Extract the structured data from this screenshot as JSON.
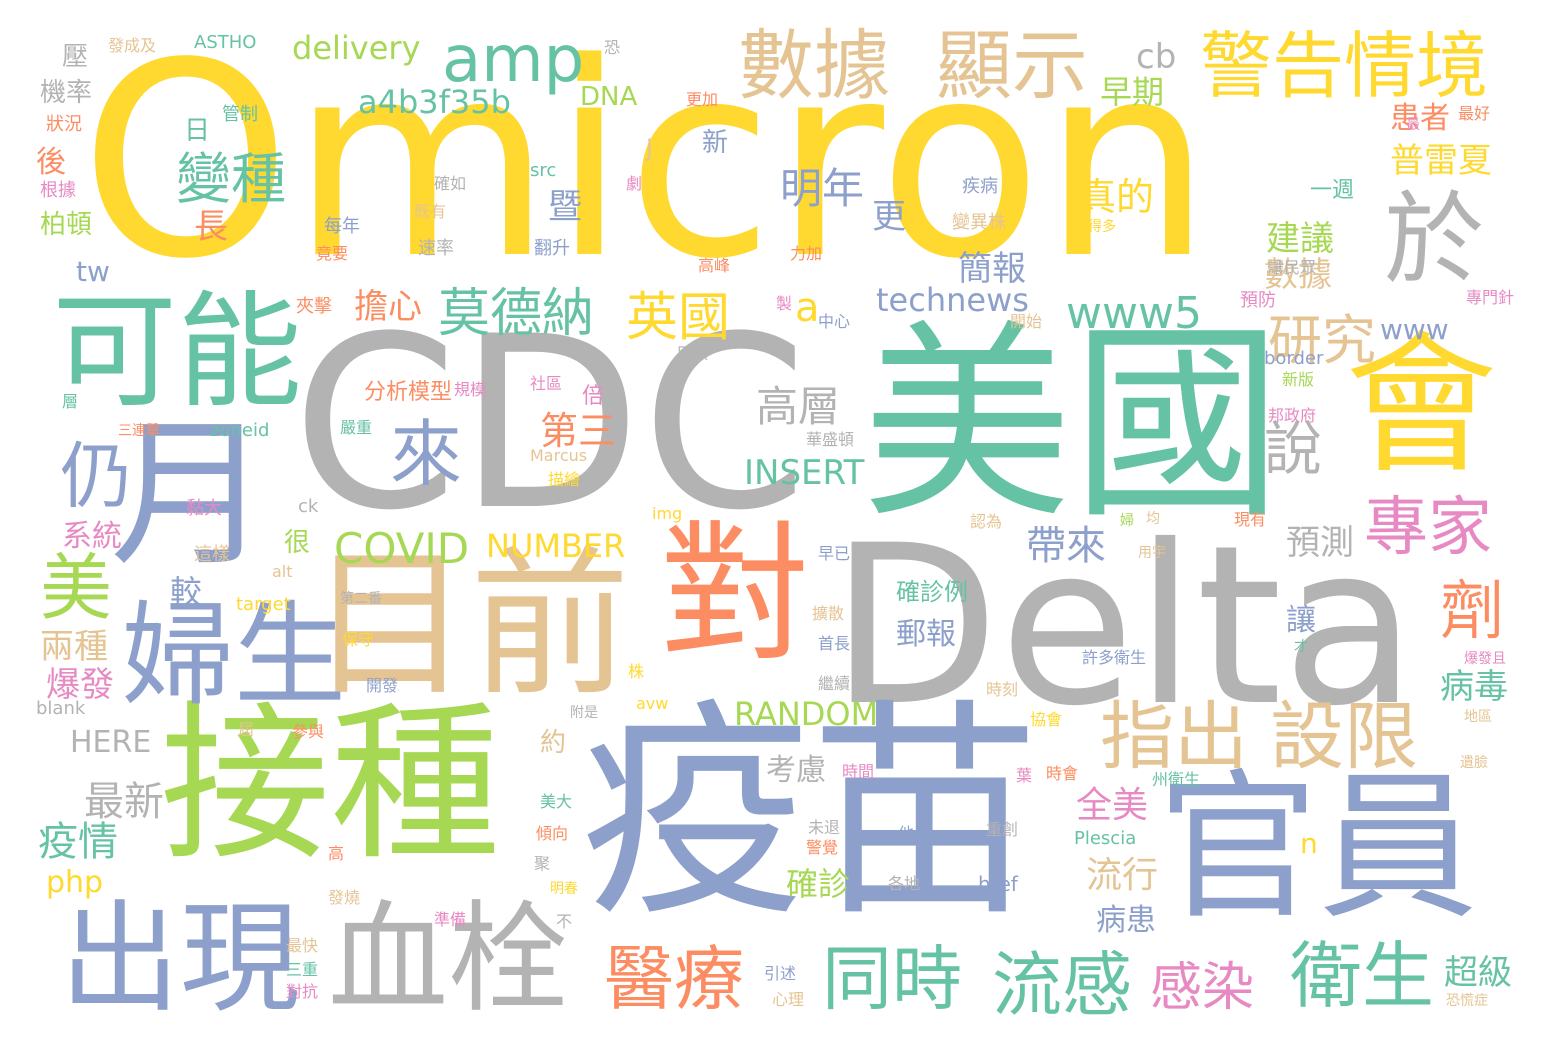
{
  "colors": {
    "yellow": "#ffd92f",
    "grey": "#b3b3b3",
    "green": "#66c2a5",
    "blue": "#8da0cb",
    "orange": "#fc8d62",
    "tan": "#e5c494",
    "lime": "#a6d854",
    "pink": "#e78ac3"
  },
  "words": [
    "Omicron",
    "CDC",
    "Delta",
    "美國",
    "疫苗",
    "接種",
    "目前",
    "對",
    "官員",
    "會",
    "月",
    "可能",
    "婦生",
    "出現",
    "血栓",
    "數據",
    "顯示",
    "警告情境",
    "amp",
    "於",
    "變種",
    "來",
    "仍",
    "美",
    "莫德納",
    "英國",
    "a",
    "www5",
    "technews",
    "研究",
    "說",
    "專家",
    "劑",
    "指出",
    "設限",
    "醫療",
    "同時",
    "流感",
    "衛生",
    "感染",
    "COVID",
    "NUMBER",
    "高層",
    "第三",
    "INSERT",
    "帶來",
    "預測",
    "a4b3f35b",
    "delivery",
    "DNA",
    "早期",
    "cb",
    "明年",
    "暨",
    "更",
    "簡報",
    "擔心",
    "分析模型",
    "倍",
    "全美",
    "流行",
    "病患",
    "確診",
    "考慮",
    "約",
    "最新",
    "疫情",
    "php",
    "系統",
    "兩種",
    "爆發",
    "RANDOM",
    "HERE",
    "病毒",
    "超級",
    "讓",
    "數據",
    "建議",
    "一週",
    "普雷夏",
    "患者",
    "真的",
    "日",
    "長",
    "tw",
    "柏頓",
    "機率",
    "壓",
    "後",
    "狀況",
    "根據",
    "較",
    "很",
    "郵報",
    "確診例",
    "src",
    "ASTHO",
    "發成及",
    "恐",
    "管制",
    "每年",
    "竟要",
    "速率",
    "翻升",
    "高峰",
    "力加",
    "變異株",
    "小得多",
    "疾病",
    "既有",
    "確如",
    "新",
    "J",
    "劇",
    "更加",
    "夾擊",
    "中心",
    "製",
    "預防",
    "讓民眾",
    "專門針",
    "開始",
    "足以",
    "border",
    "新版",
    "邦政府",
    "社區",
    "嚴重",
    "規模",
    "華盛頓",
    "Marcus",
    "描繪",
    "zoneid",
    "層",
    "三連擊",
    "ck",
    "黏大",
    "img",
    "認為",
    "婦",
    "均",
    "現有",
    "用宇",
    "早已",
    "這樣",
    "alt",
    "target",
    "擴散",
    "首長",
    "第二番",
    "保守",
    "開發",
    "許多衛生",
    "才",
    "爆發且",
    "株",
    "avw",
    "繼續",
    "時刻",
    "附是",
    "地區",
    "blank",
    "屆",
    "參與",
    "時間",
    "協會",
    "葉",
    "時會",
    "州衛生",
    "遺臉",
    "美大",
    "傾向",
    "未退",
    "警覺",
    "他們",
    "重創",
    "Plescia",
    "n",
    "高",
    "聚",
    "明春",
    "發燒",
    "各地",
    "href",
    "準備",
    "不",
    "最快",
    "三重",
    "對抗",
    "引述",
    "心理",
    "恐慌症",
    "最",
    "最好",
    "www"
  ]
}
